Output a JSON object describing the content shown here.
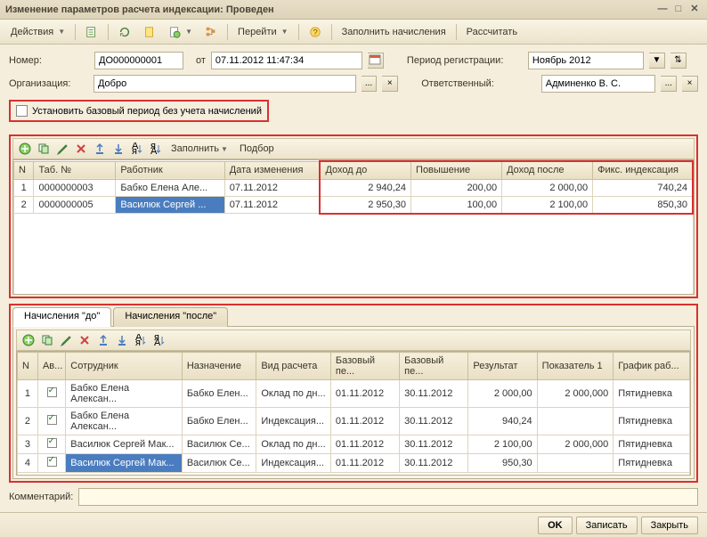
{
  "window": {
    "title": "Изменение параметров расчета индексации: Проведен"
  },
  "toolbar": {
    "actions": "Действия",
    "goto": "Перейти",
    "fill_accruals": "Заполнить начисления",
    "calculate": "Рассчитать"
  },
  "form": {
    "number_label": "Номер:",
    "number_value": "ДО000000001",
    "from_label": "от",
    "date_value": "07.11.2012 11:47:34",
    "period_label": "Период регистрации:",
    "period_value": "Ноябрь 2012",
    "org_label": "Организация:",
    "org_value": "Добро",
    "resp_label": "Ответственный:",
    "resp_value": "Админенко В. С.",
    "base_period_label": "Установить базовый период без учета начислений"
  },
  "grid1": {
    "toolbar": {
      "fill": "Заполнить",
      "select": "Подбор"
    },
    "headers": {
      "n": "N",
      "tab": "Таб. №",
      "worker": "Работник",
      "date": "Дата изменения",
      "income_before": "Доход до",
      "increase": "Повышение",
      "income_after": "Доход после",
      "fixed": "Фикс. индексация"
    },
    "rows": [
      {
        "n": "1",
        "tab": "0000000003",
        "worker": "Бабко Елена Але...",
        "date": "07.11.2012",
        "income_before": "2 940,24",
        "increase": "200,00",
        "income_after": "2 000,00",
        "fixed": "740,24",
        "sel": false
      },
      {
        "n": "2",
        "tab": "0000000005",
        "worker": "Василюк Сергей ...",
        "date": "07.11.2012",
        "income_before": "2 950,30",
        "increase": "100,00",
        "income_after": "2 100,00",
        "fixed": "850,30",
        "sel": true
      }
    ]
  },
  "tabs": {
    "before": "Начисления \"до\"",
    "after": "Начисления \"после\""
  },
  "grid2": {
    "headers": {
      "n": "N",
      "av": "Ав...",
      "emp": "Сотрудник",
      "assign": "Назначение",
      "calc_type": "Вид расчета",
      "base_from": "Базовый пе...",
      "base_to": "Базовый пе...",
      "result": "Результат",
      "ind1": "Показатель 1",
      "schedule": "График раб..."
    },
    "rows": [
      {
        "n": "1",
        "emp": "Бабко Елена Алексан...",
        "assign": "Бабко Елен...",
        "calc": "Оклад по дн...",
        "from": "01.11.2012",
        "to": "30.11.2012",
        "result": "2 000,00",
        "ind": "2 000,000",
        "sch": "Пятидневка",
        "sel": false
      },
      {
        "n": "2",
        "emp": "Бабко Елена Алексан...",
        "assign": "Бабко Елен...",
        "calc": "Индексация...",
        "from": "01.11.2012",
        "to": "30.11.2012",
        "result": "940,24",
        "ind": "",
        "sch": "Пятидневка",
        "sel": false
      },
      {
        "n": "3",
        "emp": "Василюк Сергей Мак...",
        "assign": "Василюк Се...",
        "calc": "Оклад по дн...",
        "from": "01.11.2012",
        "to": "30.11.2012",
        "result": "2 100,00",
        "ind": "2 000,000",
        "sch": "Пятидневка",
        "sel": false
      },
      {
        "n": "4",
        "emp": "Василюк Сергей Мак...",
        "assign": "Василюк Се...",
        "calc": "Индексация...",
        "from": "01.11.2012",
        "to": "30.11.2012",
        "result": "950,30",
        "ind": "",
        "sch": "Пятидневка",
        "sel": true
      }
    ]
  },
  "comment_label": "Комментарий:",
  "footer": {
    "ok": "OK",
    "save": "Записать",
    "close": "Закрыть"
  }
}
